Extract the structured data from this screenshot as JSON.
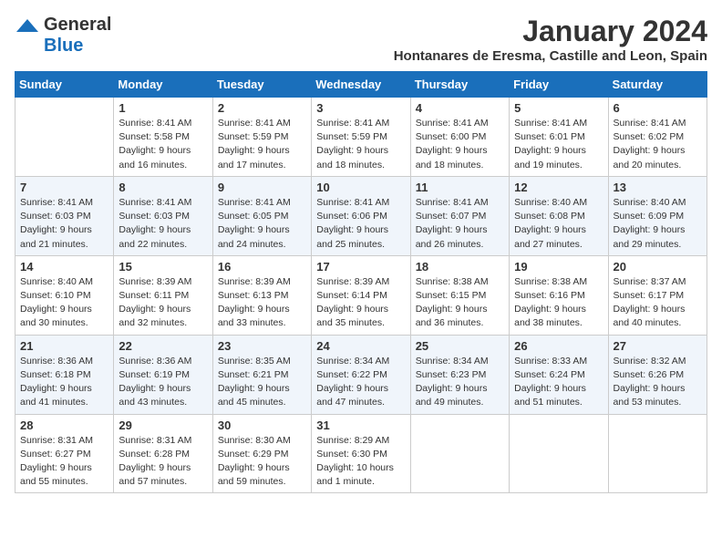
{
  "header": {
    "logo_general": "General",
    "logo_blue": "Blue",
    "month": "January 2024",
    "location": "Hontanares de Eresma, Castille and Leon, Spain"
  },
  "weekdays": [
    "Sunday",
    "Monday",
    "Tuesday",
    "Wednesday",
    "Thursday",
    "Friday",
    "Saturday"
  ],
  "weeks": [
    [
      {
        "day": "",
        "info": ""
      },
      {
        "day": "1",
        "info": "Sunrise: 8:41 AM\nSunset: 5:58 PM\nDaylight: 9 hours\nand 16 minutes."
      },
      {
        "day": "2",
        "info": "Sunrise: 8:41 AM\nSunset: 5:59 PM\nDaylight: 9 hours\nand 17 minutes."
      },
      {
        "day": "3",
        "info": "Sunrise: 8:41 AM\nSunset: 5:59 PM\nDaylight: 9 hours\nand 18 minutes."
      },
      {
        "day": "4",
        "info": "Sunrise: 8:41 AM\nSunset: 6:00 PM\nDaylight: 9 hours\nand 18 minutes."
      },
      {
        "day": "5",
        "info": "Sunrise: 8:41 AM\nSunset: 6:01 PM\nDaylight: 9 hours\nand 19 minutes."
      },
      {
        "day": "6",
        "info": "Sunrise: 8:41 AM\nSunset: 6:02 PM\nDaylight: 9 hours\nand 20 minutes."
      }
    ],
    [
      {
        "day": "7",
        "info": ""
      },
      {
        "day": "8",
        "info": "Sunrise: 8:41 AM\nSunset: 6:03 PM\nDaylight: 9 hours\nand 22 minutes."
      },
      {
        "day": "9",
        "info": "Sunrise: 8:41 AM\nSunset: 6:05 PM\nDaylight: 9 hours\nand 24 minutes."
      },
      {
        "day": "10",
        "info": "Sunrise: 8:41 AM\nSunset: 6:06 PM\nDaylight: 9 hours\nand 25 minutes."
      },
      {
        "day": "11",
        "info": "Sunrise: 8:41 AM\nSunset: 6:07 PM\nDaylight: 9 hours\nand 26 minutes."
      },
      {
        "day": "12",
        "info": "Sunrise: 8:40 AM\nSunset: 6:08 PM\nDaylight: 9 hours\nand 27 minutes."
      },
      {
        "day": "13",
        "info": "Sunrise: 8:40 AM\nSunset: 6:09 PM\nDaylight: 9 hours\nand 29 minutes."
      }
    ],
    [
      {
        "day": "14",
        "info": ""
      },
      {
        "day": "15",
        "info": "Sunrise: 8:39 AM\nSunset: 6:11 PM\nDaylight: 9 hours\nand 32 minutes."
      },
      {
        "day": "16",
        "info": "Sunrise: 8:39 AM\nSunset: 6:13 PM\nDaylight: 9 hours\nand 33 minutes."
      },
      {
        "day": "17",
        "info": "Sunrise: 8:39 AM\nSunset: 6:14 PM\nDaylight: 9 hours\nand 35 minutes."
      },
      {
        "day": "18",
        "info": "Sunrise: 8:38 AM\nSunset: 6:15 PM\nDaylight: 9 hours\nand 36 minutes."
      },
      {
        "day": "19",
        "info": "Sunrise: 8:38 AM\nSunset: 6:16 PM\nDaylight: 9 hours\nand 38 minutes."
      },
      {
        "day": "20",
        "info": "Sunrise: 8:37 AM\nSunset: 6:17 PM\nDaylight: 9 hours\nand 40 minutes."
      }
    ],
    [
      {
        "day": "21",
        "info": ""
      },
      {
        "day": "22",
        "info": "Sunrise: 8:36 AM\nSunset: 6:19 PM\nDaylight: 9 hours\nand 43 minutes."
      },
      {
        "day": "23",
        "info": "Sunrise: 8:35 AM\nSunset: 6:21 PM\nDaylight: 9 hours\nand 45 minutes."
      },
      {
        "day": "24",
        "info": "Sunrise: 8:34 AM\nSunset: 6:22 PM\nDaylight: 9 hours\nand 47 minutes."
      },
      {
        "day": "25",
        "info": "Sunrise: 8:34 AM\nSunset: 6:23 PM\nDaylight: 9 hours\nand 49 minutes."
      },
      {
        "day": "26",
        "info": "Sunrise: 8:33 AM\nSunset: 6:24 PM\nDaylight: 9 hours\nand 51 minutes."
      },
      {
        "day": "27",
        "info": "Sunrise: 8:32 AM\nSunset: 6:26 PM\nDaylight: 9 hours\nand 53 minutes."
      }
    ],
    [
      {
        "day": "28",
        "info": "Sunrise: 8:31 AM\nSunset: 6:27 PM\nDaylight: 9 hours\nand 55 minutes."
      },
      {
        "day": "29",
        "info": "Sunrise: 8:31 AM\nSunset: 6:28 PM\nDaylight: 9 hours\nand 57 minutes."
      },
      {
        "day": "30",
        "info": "Sunrise: 8:30 AM\nSunset: 6:29 PM\nDaylight: 9 hours\nand 59 minutes."
      },
      {
        "day": "31",
        "info": "Sunrise: 8:29 AM\nSunset: 6:30 PM\nDaylight: 10 hours\nand 1 minute."
      },
      {
        "day": "",
        "info": ""
      },
      {
        "day": "",
        "info": ""
      },
      {
        "day": "",
        "info": ""
      }
    ]
  ],
  "week7_sunday": "Sunrise: 8:36 AM\nSunset: 6:18 PM\nDaylight: 9 hours\nand 41 minutes.",
  "week3_sunday": "Sunrise: 8:40 AM\nSunset: 6:10 PM\nDaylight: 9 hours\nand 30 minutes.",
  "week2_sunday": "Sunrise: 8:41 AM\nSunset: 6:03 PM\nDaylight: 9 hours\nand 21 minutes."
}
